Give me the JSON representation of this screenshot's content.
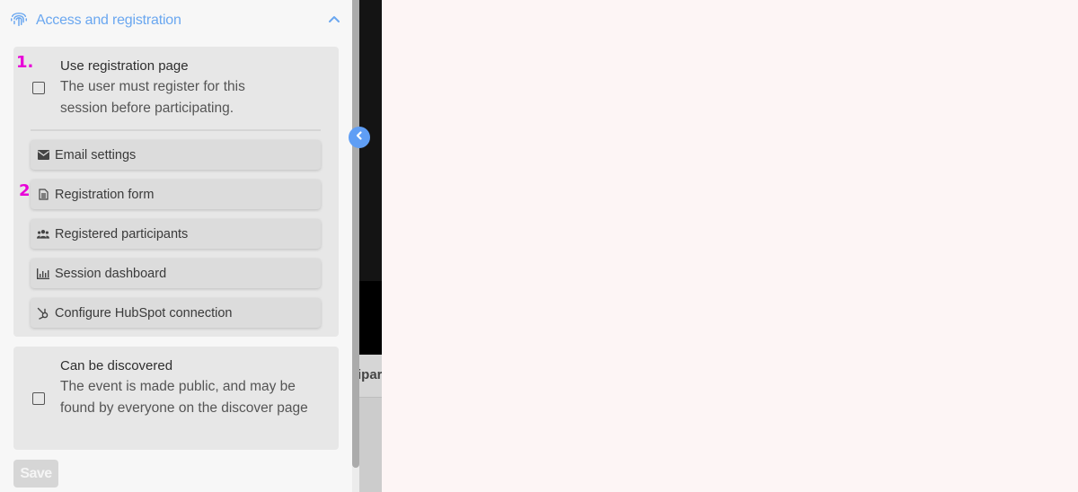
{
  "section": {
    "title": "Access and registration",
    "icon": "fingerprint-icon",
    "expanded": true
  },
  "registration": {
    "marker": "1.",
    "title": "Use registration page",
    "description": "The user must register for this session before participating.",
    "checked": false,
    "buttons": [
      {
        "label": "Email settings",
        "icon": "mail-icon"
      },
      {
        "label": "Registration form",
        "icon": "document-icon",
        "marker": "2."
      },
      {
        "label": "Registered participants",
        "icon": "people-icon"
      },
      {
        "label": "Session dashboard",
        "icon": "bar-chart-icon"
      },
      {
        "label": "Configure HubSpot connection",
        "icon": "hubspot-icon"
      }
    ]
  },
  "discover": {
    "title": "Can be discovered",
    "description": "The event is made public, and may be found by everyone on the discover page",
    "checked": false
  },
  "save_label": "Save",
  "background_tab_fragment": "ipar",
  "colors": {
    "accent": "#6aa7f0",
    "collapse_button": "#5f9ef5",
    "marker": "#e800d8"
  }
}
